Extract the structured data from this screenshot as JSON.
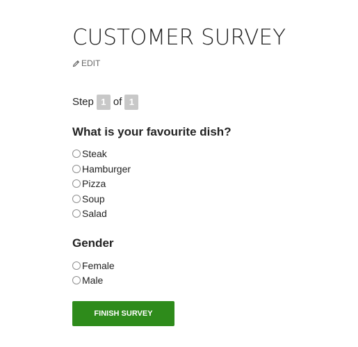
{
  "survey": {
    "title": "CUSTOMER SURVEY",
    "edit_label": "EDIT",
    "edit_icon": "pencil-icon"
  },
  "step": {
    "prefix": "Step",
    "current": "1",
    "separator": "of",
    "total": "1"
  },
  "questions": [
    {
      "text": "What is your favourite dish?",
      "options": [
        "Steak",
        "Hamburger",
        "Pizza",
        "Soup",
        "Salad"
      ]
    },
    {
      "text": "Gender",
      "options": [
        "Female",
        "Male"
      ]
    }
  ],
  "actions": {
    "finish_label": "FINISH SURVEY"
  },
  "colors": {
    "finish_button": "#2e8b1b",
    "step_badge": "#c8c8c8"
  }
}
